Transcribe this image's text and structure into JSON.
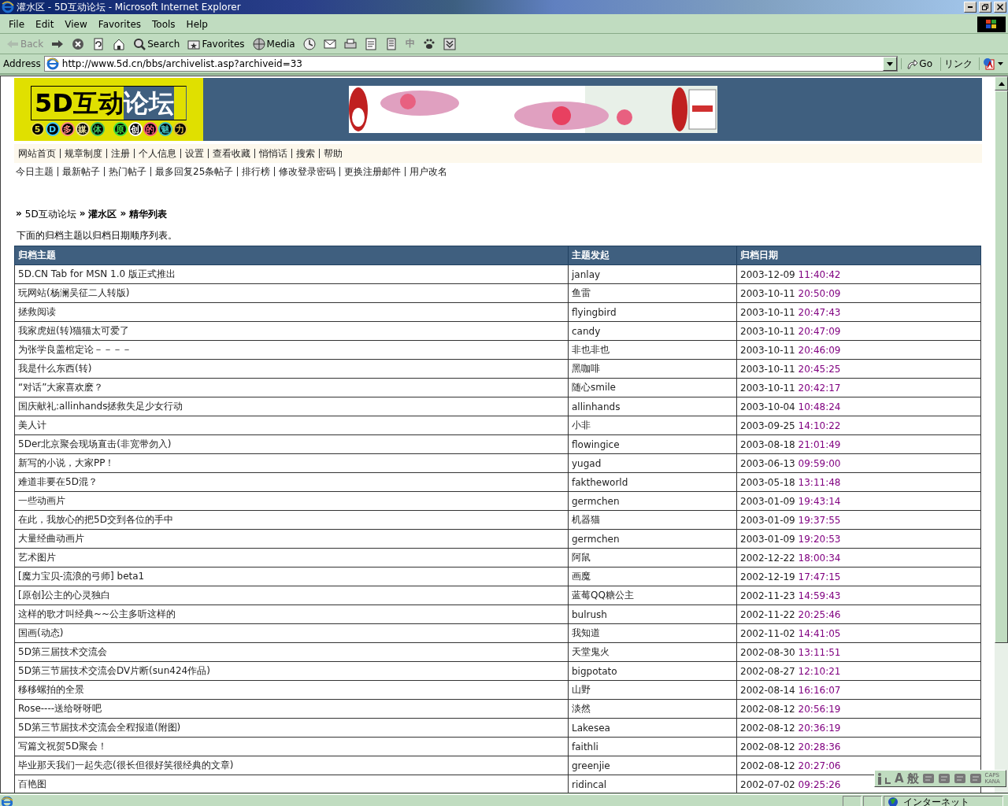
{
  "window": {
    "title": "灌水区 - 5D互动论坛 - Microsoft Internet Explorer"
  },
  "menu": [
    "File",
    "Edit",
    "View",
    "Favorites",
    "Tools",
    "Help"
  ],
  "toolbar": [
    {
      "kind": "back",
      "label": "Back",
      "disabled": true
    },
    {
      "kind": "forward",
      "disabled": false
    },
    {
      "kind": "stop"
    },
    {
      "kind": "refresh"
    },
    {
      "kind": "home"
    },
    {
      "kind": "search",
      "label": "Search",
      "disabled": false
    },
    {
      "kind": "favorites",
      "label": "Favorites",
      "disabled": false
    },
    {
      "kind": "media",
      "label": "Media",
      "disabled": false
    },
    {
      "kind": "history"
    },
    {
      "kind": "mail"
    },
    {
      "kind": "print"
    },
    {
      "kind": "edit"
    },
    {
      "kind": "discuss"
    },
    {
      "kind": "ime",
      "label": "中",
      "disabled": true
    },
    {
      "kind": "paw"
    },
    {
      "kind": "down"
    }
  ],
  "address": {
    "label": "Address",
    "value": "http://www.5d.cn/bbs/archivelist.asp?archiveid=33",
    "go": "Go",
    "links": "リンク"
  },
  "logo": {
    "title_a": "5D互动",
    "title_b": "论坛",
    "tagline": [
      {
        "char": "5",
        "color": "#e8e040"
      },
      {
        "char": "D",
        "color": "#40c8ff"
      },
      {
        "char": "多",
        "color": "#ff8a80"
      },
      {
        "char": "媒",
        "color": "#e8e0a0"
      },
      {
        "char": "体",
        "color": "#40c060"
      },
      {
        "char": "原",
        "color": "#40e040"
      },
      {
        "char": "创",
        "color": "#ffffff"
      },
      {
        "char": "的",
        "color": "#ff6080"
      },
      {
        "char": "魅",
        "color": "#40c0c0"
      },
      {
        "char": "力",
        "color": "#e0c040"
      }
    ]
  },
  "nav_primary": [
    "网站首页",
    "规章制度",
    "注册",
    "个人信息",
    "设置",
    "查看收藏",
    "悄悄话",
    "搜索",
    "帮助"
  ],
  "nav_secondary": [
    "今日主题",
    "最新帖子",
    "热门帖子",
    "最多回复25条帖子",
    "排行榜",
    "修改登录密码",
    "更换注册邮件",
    "用户改名"
  ],
  "breadcrumb": [
    {
      "mark": "»",
      "text": "5D互动论坛",
      "bold": false
    },
    {
      "mark": "»",
      "text": "灌水区",
      "bold": true
    },
    {
      "mark": "»",
      "text": "精华列表",
      "bold": true
    }
  ],
  "intro": "下面的归档主题以归档日期顺序列表。",
  "table": {
    "columns": [
      "归档主题",
      "主题发起",
      "归档日期"
    ],
    "rows": [
      {
        "topic": "5D.CN Tab for MSN 1.0 版正式推出",
        "author": "janlay",
        "date": "2003-12-09",
        "time": "11:40:42"
      },
      {
        "topic": "玩网站(杨澜吴征二人转版)",
        "author": "鱼雷",
        "date": "2003-10-11",
        "time": "20:50:09"
      },
      {
        "topic": "拯救阅读",
        "author": "flyingbird",
        "date": "2003-10-11",
        "time": "20:47:43"
      },
      {
        "topic": "我家虎妞(转)猫猫太可爱了",
        "author": "candy",
        "date": "2003-10-11",
        "time": "20:47:09"
      },
      {
        "topic": "为张学良盖棺定论－－－－",
        "author": "非也非也",
        "date": "2003-10-11",
        "time": "20:46:09"
      },
      {
        "topic": "我是什么东西(转)",
        "author": "黑咖啡",
        "date": "2003-10-11",
        "time": "20:45:25"
      },
      {
        "topic": "“对话”大家喜欢麽？",
        "author": "随心smile",
        "date": "2003-10-11",
        "time": "20:42:17"
      },
      {
        "topic": "国庆献礼:allinhands拯救失足少女行动",
        "author": "allinhands",
        "date": "2003-10-04",
        "time": "10:48:24"
      },
      {
        "topic": "美人计",
        "author": "小非",
        "date": "2003-09-25",
        "time": "14:10:22"
      },
      {
        "topic": "5Der北京聚会现场直击(非宽带勿入)",
        "author": "flowingice",
        "date": "2003-08-18",
        "time": "21:01:49"
      },
      {
        "topic": "新写的小说，大家PP！",
        "author": "yugad",
        "date": "2003-06-13",
        "time": "09:59:00"
      },
      {
        "topic": "难道非要在5D混？",
        "author": "faktheworld",
        "date": "2003-05-18",
        "time": "13:11:48"
      },
      {
        "topic": "一些动画片",
        "author": "germchen",
        "date": "2003-01-09",
        "time": "19:43:14"
      },
      {
        "topic": "在此，我放心的把5D交到各位的手中",
        "author": "机器猫",
        "date": "2003-01-09",
        "time": "19:37:55"
      },
      {
        "topic": "大量经曲动画片",
        "author": "germchen",
        "date": "2003-01-09",
        "time": "19:20:53"
      },
      {
        "topic": "艺术图片",
        "author": "阿鼠",
        "date": "2002-12-22",
        "time": "18:00:34"
      },
      {
        "topic": "[魔力宝贝-流浪的弓师] beta1",
        "author": "画魔",
        "date": "2002-12-19",
        "time": "17:47:15"
      },
      {
        "topic": "[原创]公主的心灵独白",
        "author": "蓝莓QQ糖公主",
        "date": "2002-11-23",
        "time": "14:59:43"
      },
      {
        "topic": "这样的歌才叫经典~~公主多听这样的",
        "author": "bulrush",
        "date": "2002-11-22",
        "time": "20:25:46"
      },
      {
        "topic": "国画(动态)",
        "author": "我知道",
        "date": "2002-11-02",
        "time": "14:41:05"
      },
      {
        "topic": "5D第三届技术交流会",
        "author": "天堂鬼火",
        "date": "2002-08-30",
        "time": "13:11:51"
      },
      {
        "topic": "5D第三节届技术交流会DV片断(sun424作品)",
        "author": "bigpotato",
        "date": "2002-08-27",
        "time": "12:10:21"
      },
      {
        "topic": "移移螺拍的全景",
        "author": "山野",
        "date": "2002-08-14",
        "time": "16:16:07"
      },
      {
        "topic": "Rose----送给呀呀吧",
        "author": "淡然",
        "date": "2002-08-12",
        "time": "20:56:19"
      },
      {
        "topic": "5D第三节届技术交流会全程报道(附图)",
        "author": "Lakesea",
        "date": "2002-08-12",
        "time": "20:36:19"
      },
      {
        "topic": "写篇文祝贺5D聚会！",
        "author": "faithli",
        "date": "2002-08-12",
        "time": "20:28:36"
      },
      {
        "topic": "毕业那天我们一起失恋(很长但很好笑很经典的文章)",
        "author": "greenjie",
        "date": "2002-08-12",
        "time": "20:27:06"
      },
      {
        "topic": "百艳图",
        "author": "ridincal",
        "date": "2002-07-02",
        "time": "09:25:26"
      }
    ]
  },
  "status_bar": {
    "zone": "インターネット"
  },
  "ime_bar": {
    "mode": "A",
    "kanji": "般",
    "caps": "CAPS",
    "kana": "KANA"
  }
}
